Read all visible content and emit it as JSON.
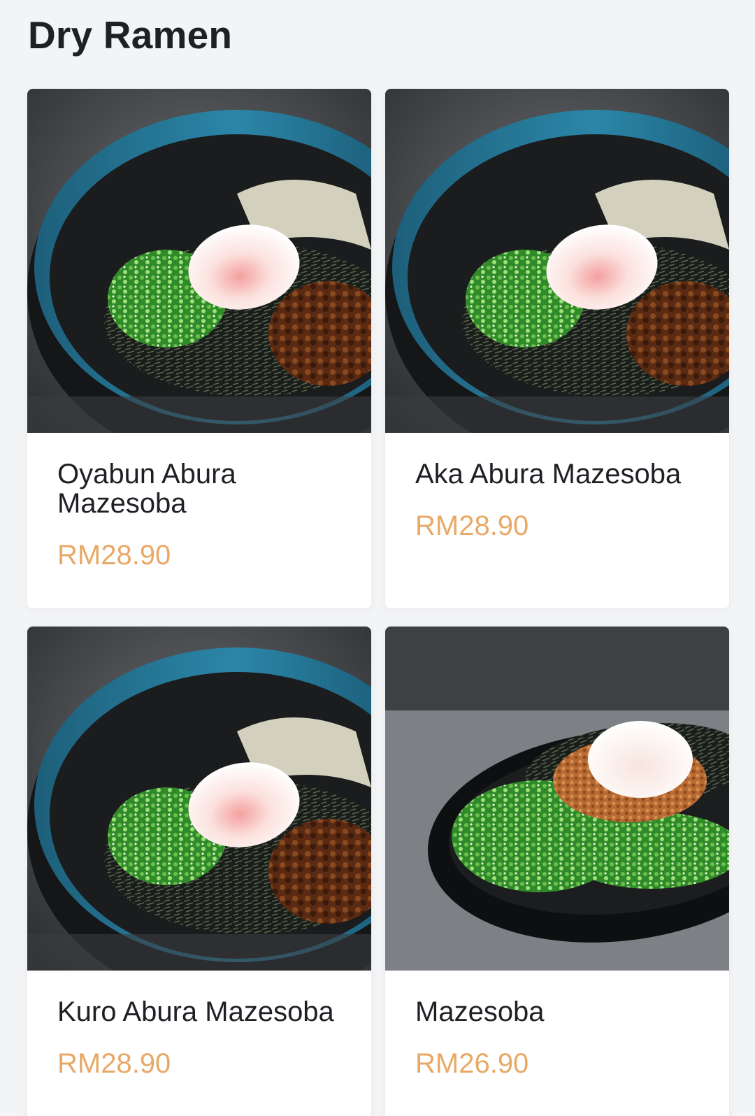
{
  "section": {
    "title": "Dry Ramen"
  },
  "colors": {
    "price": "#e8a968",
    "text": "#1f2025",
    "background": "#f3f4f6"
  },
  "items": [
    {
      "name": "Oyabun Abura Mazesoba",
      "price": "RM28.90",
      "photo": "blue-bowl-ramen-photo"
    },
    {
      "name": "Aka Abura Mazesoba",
      "price": "RM28.90",
      "photo": "blue-bowl-ramen-photo"
    },
    {
      "name": "Kuro Abura Mazesoba",
      "price": "RM28.90",
      "photo": "blue-bowl-ramen-photo"
    },
    {
      "name": "Mazesoba",
      "price": "RM26.90",
      "photo": "black-plate-mazesoba-photo"
    }
  ]
}
